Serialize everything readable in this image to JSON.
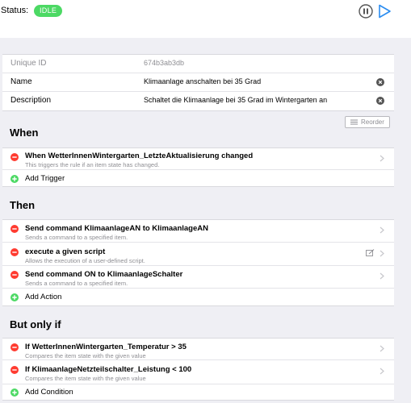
{
  "header": {
    "status_label": "Status:",
    "status_value": "IDLE",
    "status_color": "#4cd964",
    "pause_icon": "pause-circle-icon",
    "play_icon": "play-icon",
    "accent": "#2a8cf0"
  },
  "info": {
    "uid_label": "Unique ID",
    "uid_value": "674b3ab3db",
    "name_label": "Name",
    "name_value": "Klimaanlage anschalten bei 35 Grad",
    "desc_label": "Description",
    "desc_value": "Schaltet die Klimaanlage bei 35 Grad im Wintergarten an"
  },
  "reorder_label": "Reorder",
  "when": {
    "title": "When",
    "items": [
      {
        "title": "When WetterInnenWintergarten_LetzteAktualisierung changed",
        "subtitle": "This triggers the rule if an item state has changed."
      }
    ],
    "add_label": "Add Trigger"
  },
  "then": {
    "title": "Then",
    "items": [
      {
        "title": "Send command KlimaanlageAN to KlimaanlageAN",
        "subtitle": "Sends a command to a specified item."
      },
      {
        "title": "execute a given script",
        "subtitle": "Allows the execution of a user-defined script."
      },
      {
        "title": "Send command ON to KlimaanlageSchalter",
        "subtitle": "Sends a command to a specified item."
      }
    ],
    "add_label": "Add Action"
  },
  "conditions": {
    "title": "But only if",
    "items": [
      {
        "title": "If WetterInnenWintergarten_Temperatur > 35",
        "subtitle": "Compares the item state with the given value"
      },
      {
        "title": "If KlimaanlageNetzteilschalter_Leistung < 100",
        "subtitle": "Compares the item state with the given value"
      }
    ],
    "add_label": "Add Condition"
  },
  "colors": {
    "remove": "#ff3b30",
    "add": "#4cd964",
    "muted": "#8e8e93"
  }
}
